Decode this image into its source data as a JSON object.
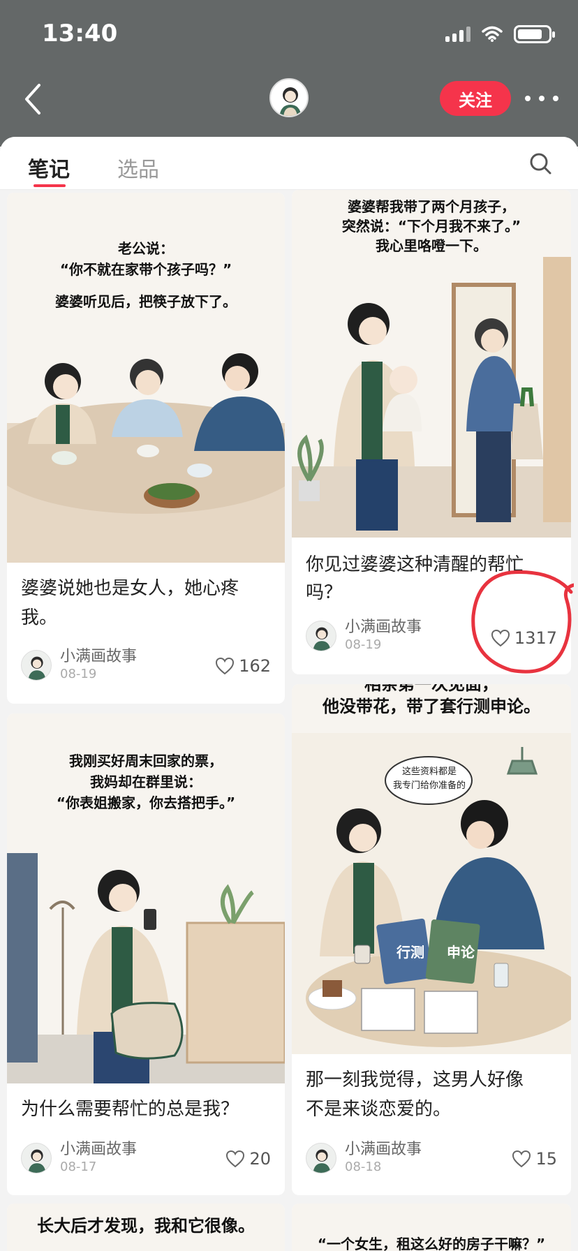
{
  "status": {
    "time": "13:40",
    "battery_level": 0.8
  },
  "header": {
    "follow_label": "关注"
  },
  "tabs": [
    {
      "label": "笔记",
      "active": true
    },
    {
      "label": "选品",
      "active": false
    }
  ],
  "cards": [
    {
      "caption": [
        "老公说：",
        "“你不就在家带个孩子吗？”",
        "婆婆听见后，把筷子放下了。"
      ],
      "title_lines": [
        "婆婆说她也是女人，她心疼",
        "我。"
      ],
      "author": "小满画故事",
      "date": "08-19",
      "likes": "162"
    },
    {
      "caption": [
        "婆婆帮我带了两个月孩子，",
        "突然说：“下个月我不来了。”",
        "我心里咯噔一下。"
      ],
      "title_lines": [
        "你见过婆婆这种清醒的帮忙",
        "吗？"
      ],
      "author": "小满画故事",
      "date": "08-19",
      "likes": "1317"
    },
    {
      "caption": [
        "我刚买好周末回家的票，",
        "我妈却在群里说：",
        "“你表姐搬家，你去搭把手。”"
      ],
      "title_lines": [
        "为什么需要帮忙的总是我？"
      ],
      "author": "小满画故事",
      "date": "08-17",
      "likes": "20"
    },
    {
      "caption": [
        "相亲第一次见面，",
        "他没带花，带了套行测申论。"
      ],
      "bubble": [
        "这些资料都是",
        "我专门给你准备的"
      ],
      "book_labels": [
        "行测",
        "申论"
      ],
      "title_lines": [
        "那一刻我觉得，这男人好像",
        "不是来谈恋爱的。"
      ],
      "author": "小满画故事",
      "date": "08-18",
      "likes": "15"
    },
    {
      "caption": [
        "长大后才发现，我和它很像。"
      ]
    },
    {
      "caption": [
        "“一个女生，租这么好的房子干嘛？”"
      ]
    }
  ],
  "colors": {
    "accent": "#f5344b",
    "header_bg": "#646868"
  }
}
